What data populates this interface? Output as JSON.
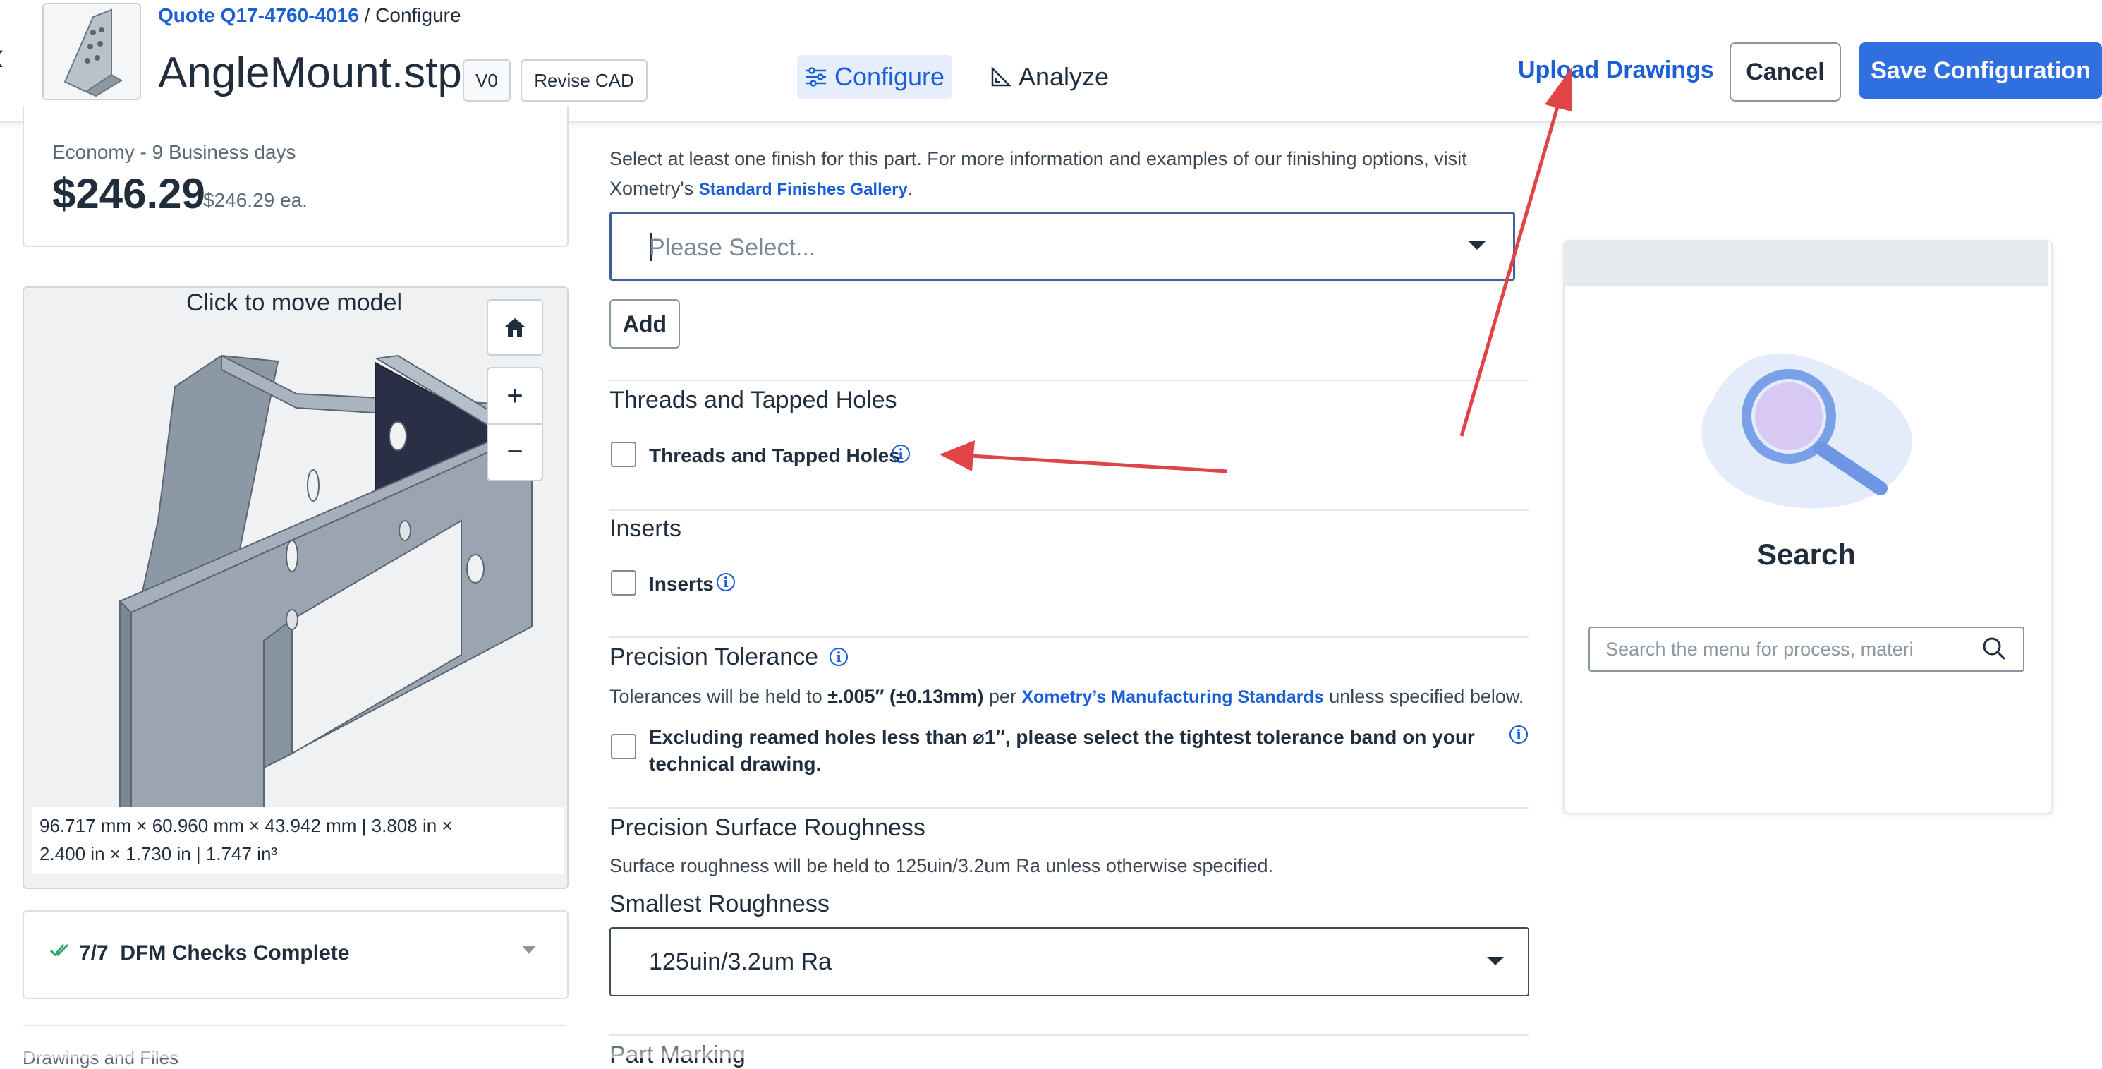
{
  "header": {
    "breadcrumb_link": "Quote Q17-4760-4016",
    "breadcrumb_sep": " / ",
    "breadcrumb_current": "Configure",
    "filename": "AngleMount.stp",
    "version_badge": "V0",
    "revise_label": "Revise CAD",
    "tabs": [
      {
        "label": "Configure",
        "icon": "sliders-icon",
        "active": true
      },
      {
        "label": "Analyze",
        "icon": "ruler-triangle-icon",
        "active": false
      }
    ],
    "upload_label": "Upload Drawings",
    "cancel_label": "Cancel",
    "save_label": "Save Configuration"
  },
  "pricing": {
    "lead_time": "Economy - 9 Business days",
    "price": "$246.29",
    "price_each": "$246.29 ea."
  },
  "viewer": {
    "caption": "Click to move model",
    "home_icon": "home-icon",
    "zoom_in": "+",
    "zoom_out": "−",
    "dims_line1": "96.717 mm × 60.960 mm × 43.942 mm  |  3.808 in ×",
    "dims_line2": "2.400 in × 1.730 in | 1.747 in³"
  },
  "dfm": {
    "count": "7/7",
    "label": "DFM Checks Complete"
  },
  "drawings_label": "Drawings and Files",
  "finish": {
    "desc_part1": "Select at least one finish for this part. For more information and examples of our finishing options, visit",
    "desc_part2": "Xometry's ",
    "desc_link": "Standard Finishes Gallery",
    "desc_end": ".",
    "select_placeholder": "Please Select...",
    "add_label": "Add"
  },
  "threads": {
    "title": "Threads and Tapped Holes",
    "checkbox_label": "Threads and Tapped Holes"
  },
  "inserts": {
    "title": "Inserts",
    "checkbox_label": "Inserts"
  },
  "tolerance": {
    "title": "Precision Tolerance",
    "desc_pre": "Tolerances will be held to ",
    "desc_bold": "±.005″ (±0.13mm)",
    "desc_mid": " per ",
    "desc_link": "Xometry’s Manufacturing Standards",
    "desc_post": " unless specified below.",
    "checkbox_line1": "Excluding reamed holes less than ⌀1″, please select the tightest tolerance band on your",
    "checkbox_line2": "technical drawing."
  },
  "roughness": {
    "title": "Precision Surface Roughness",
    "desc": "Surface roughness will be held to 125uin/3.2um Ra unless otherwise specified.",
    "smallest_label": "Smallest Roughness",
    "selected": "125uin/3.2um Ra"
  },
  "part_marking_label": "Part Marking",
  "search": {
    "title": "Search",
    "placeholder": "Search the menu for process, materi"
  },
  "colors": {
    "accent": "#1a5fd6",
    "save_button": "#2f6fe0",
    "annotation_arrow": "#e04446",
    "check_green": "#2aa66b"
  }
}
